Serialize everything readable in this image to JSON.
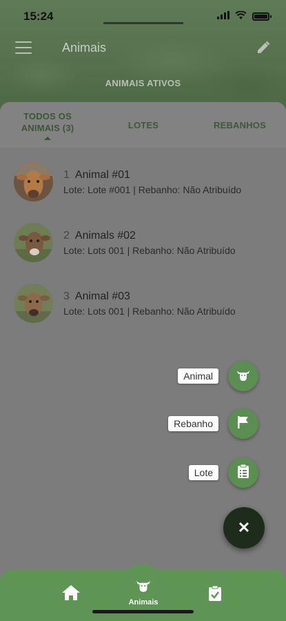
{
  "status": {
    "time": "15:24"
  },
  "app_bar": {
    "title": "Animais"
  },
  "active_tab": {
    "label": "ANIMAIS ATIVOS"
  },
  "subtabs": [
    {
      "line1": "TODOS OS",
      "line2": "ANIMAIS (3)"
    },
    {
      "label": "LOTES"
    },
    {
      "label": "REBANHOS"
    }
  ],
  "animals": [
    {
      "index": "1",
      "name": "Animal #01",
      "detail": "Lote: Lote #001 | Rebanho: Não Atribuído"
    },
    {
      "index": "2",
      "name": "Animals #02",
      "detail": "Lote: Lots 001 | Rebanho: Não Atribuído"
    },
    {
      "index": "3",
      "name": "Animal #03",
      "detail": "Lote: Lots 001 | Rebanho: Não Atribuído"
    }
  ],
  "fab_menu": {
    "animal_label": "Animal",
    "rebanho_label": "Rebanho",
    "lote_label": "Lote",
    "close_symbol": "✕"
  },
  "bottom_nav": {
    "animais_label": "Animais"
  },
  "colors": {
    "brand_green": "#5f9554",
    "dark_green": "#1e2d1b"
  }
}
